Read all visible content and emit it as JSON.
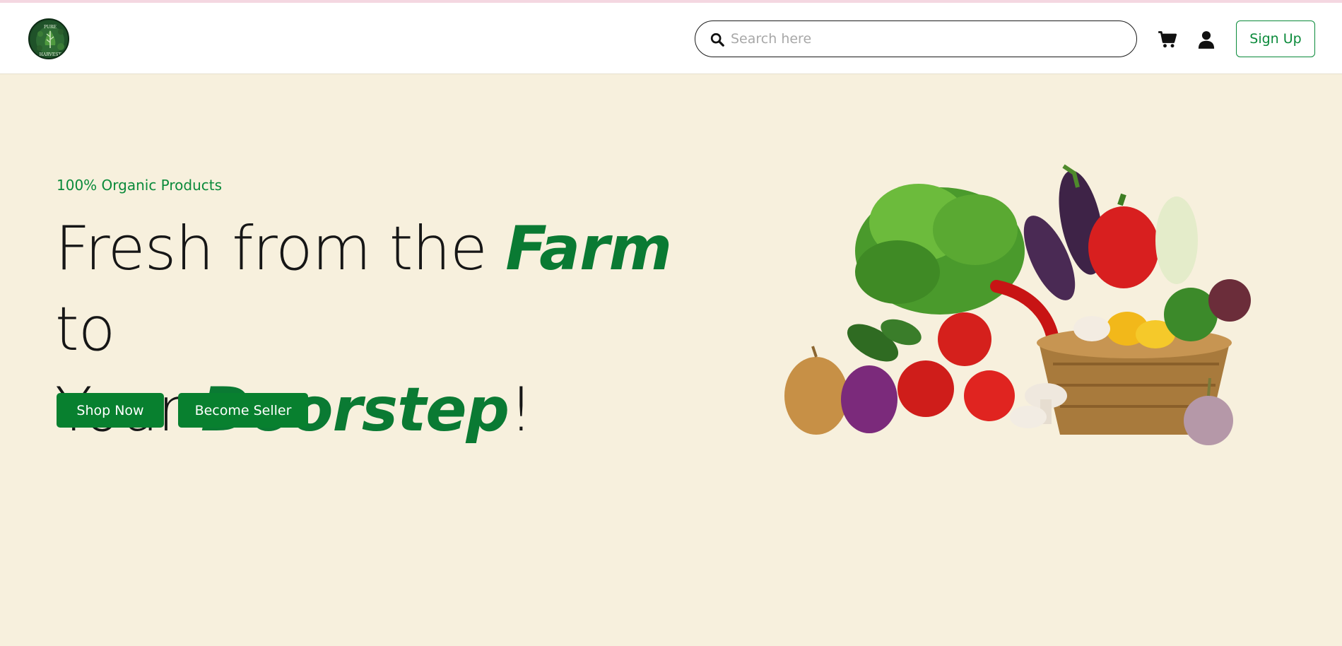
{
  "header": {
    "logo_text_top": "PURE",
    "logo_text_bottom": "HARVEST",
    "search": {
      "placeholder": "Search here",
      "value": ""
    },
    "cart_icon": "cart-icon",
    "user_icon": "user-icon",
    "signup_label": "Sign Up"
  },
  "hero": {
    "tagline": "100% Organic Products",
    "headline": {
      "line1_part1": "Fresh from the ",
      "line1_accent": "Farm",
      "line1_part2": " to",
      "line2_part1": "Your ",
      "line2_accent": "Doorstep",
      "line2_part2": "!"
    },
    "buttons": {
      "shop_now": "Shop Now",
      "become_seller": "Become Seller"
    },
    "image": "vegetable-basket-illustration"
  },
  "colors": {
    "brand_green": "#0a8a3a",
    "button_green": "#08802f",
    "hero_background": "#f7f0dd",
    "header_background": "#ffffff"
  }
}
